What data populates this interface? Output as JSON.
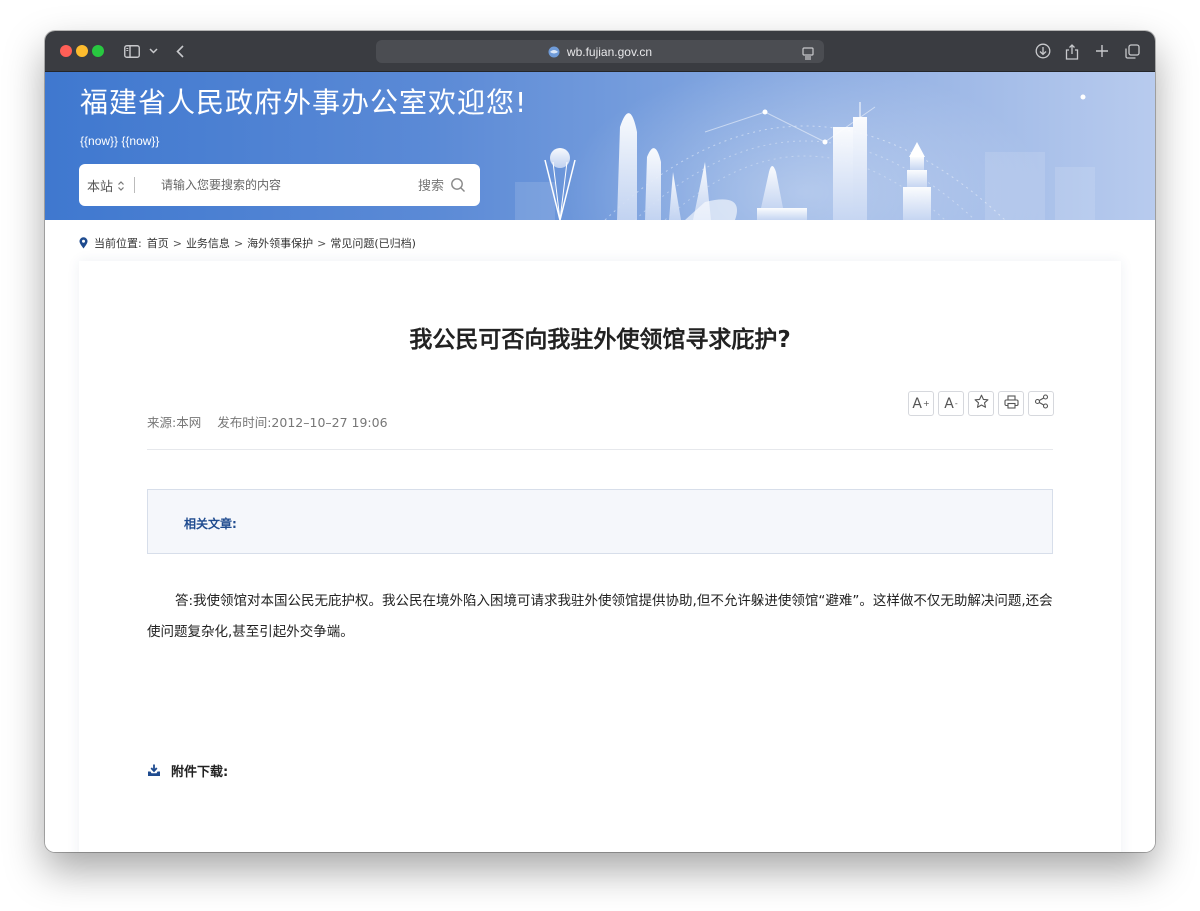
{
  "browser": {
    "url": "wb.fujian.gov.cn"
  },
  "site": {
    "title": "福建省人民政府外事办公室欢迎您!",
    "date_line": "{{now}} {{now}}"
  },
  "search": {
    "scope": "本站",
    "placeholder": "请输入您要搜索的内容",
    "button": "搜索"
  },
  "breadcrumb": {
    "label": "当前位置:",
    "items": [
      "首页",
      "业务信息",
      "海外领事保护",
      "常见问题(已归档)"
    ],
    "separator": ">"
  },
  "article": {
    "title": "我公民可否向我驻外使领馆寻求庇护?",
    "source": "来源:本网",
    "published": "发布时间:2012–10–27 19:06",
    "related_label": "相关文章:",
    "body": "答:我使领馆对本国公民无庇护权。我公民在境外陷入困境可请求我驻外使领馆提供协助,但不允许躲进使领馆“避难”。这样做不仅无助解决问题,还会使问题复杂化,甚至引起外交争端。",
    "attachments_label": "附件下载:"
  },
  "tools": {
    "font_larger": "A",
    "font_larger_mark": "+",
    "font_smaller": "A",
    "font_smaller_mark": "-"
  },
  "icons": {
    "toolbar": [
      "sidebar-icon",
      "chevron-down-icon",
      "back-icon",
      "globe-icon",
      "reader-icon",
      "download-icon",
      "share-icon",
      "plus-icon",
      "tabs-icon"
    ],
    "page": [
      "location-pin-icon",
      "search-icon",
      "star-icon",
      "print-icon",
      "share-icon",
      "download-tray-icon"
    ]
  },
  "colors": {
    "banner": "#4a7fd1",
    "link_accent": "#1f4b8f",
    "related_bg": "#f5f7fb"
  }
}
